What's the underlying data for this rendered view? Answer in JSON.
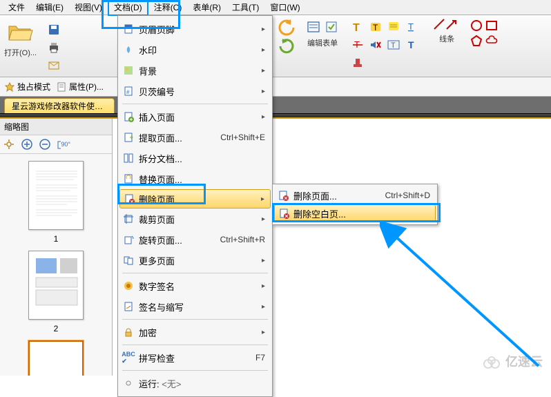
{
  "menubar": {
    "file": "文件",
    "edit": "编辑(E)",
    "view": "视图(V)",
    "document": "文档(D)",
    "comment": "注释(C)",
    "form": "表单(R)",
    "tools": "工具(T)",
    "window": "窗口(W)"
  },
  "toolbar": {
    "open": "打开(O)...",
    "zoom_in": "放大",
    "zoom_out": "缩小",
    "edit_form": "编辑表单",
    "lines": "线条"
  },
  "secondary": {
    "exclusive_mode": "独占模式",
    "properties": "属性(P)..."
  },
  "tab": {
    "label": "星云游戏修改器软件使用说明"
  },
  "thumbs": {
    "title": "缩略图",
    "page1": "1",
    "page2": "2"
  },
  "menu": {
    "header_footer": "页眉页脚",
    "watermark": "水印",
    "background": "背景",
    "bates": "贝茨编号",
    "insert": "插入页面",
    "extract": "提取页面...",
    "extract_shortcut": "Ctrl+Shift+E",
    "split": "拆分文档...",
    "replace": "替换页面...",
    "delete": "删除页面",
    "crop": "裁剪页面",
    "rotate": "旋转页面...",
    "rotate_shortcut": "Ctrl+Shift+R",
    "more": "更多页面",
    "sign": "数字签名",
    "abbrev": "签名与缩写",
    "encrypt": "加密",
    "spell": "拼写检查",
    "spell_shortcut": "F7",
    "run": "运行:"
  },
  "submenu": {
    "delete_pages": "删除页面...",
    "delete_pages_shortcut": "Ctrl+Shift+D",
    "delete_blank": "删除空白页..."
  },
  "status": {
    "run": "运行:",
    "none": "<无>"
  },
  "watermark_text": "亿速云"
}
